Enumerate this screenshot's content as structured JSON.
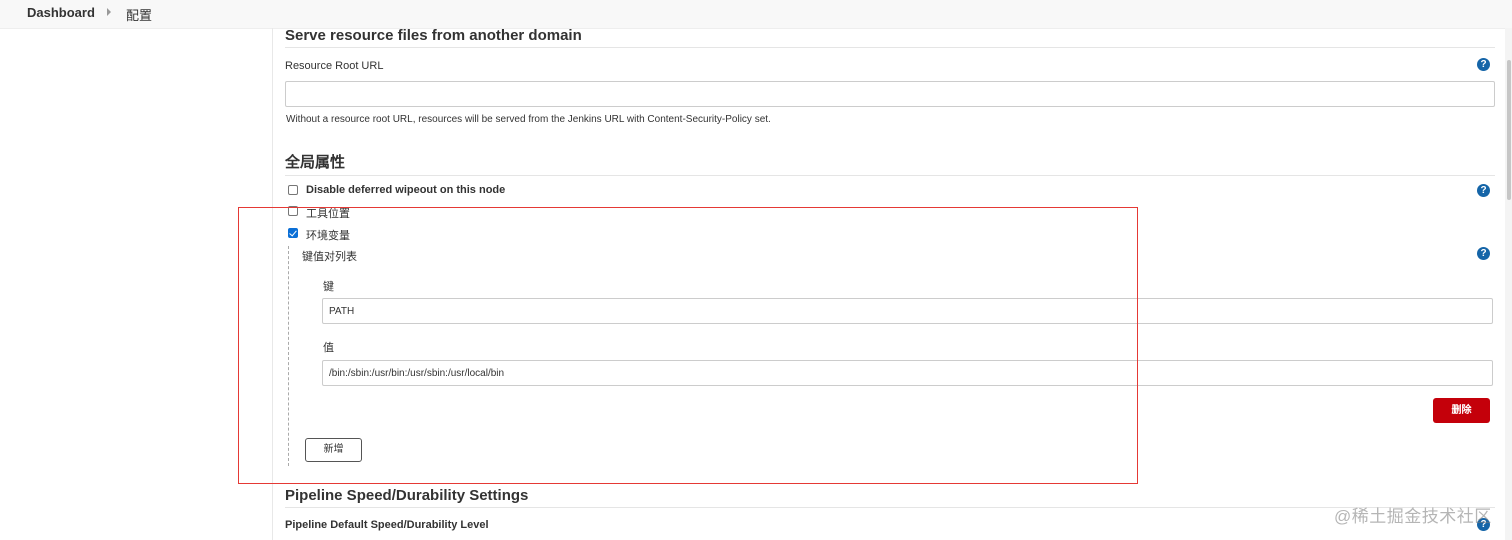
{
  "breadcrumb": {
    "dashboard": "Dashboard",
    "current": "配置"
  },
  "resource_section": {
    "title": "Serve resource files from another domain",
    "field_label": "Resource Root URL",
    "input_value": "",
    "helper": "Without a resource root URL, resources will be served from the Jenkins URL with Content-Security-Policy set."
  },
  "global_props": {
    "title": "全局属性",
    "options": [
      {
        "label": "Disable deferred wipeout on this node",
        "checked": false
      },
      {
        "label": "工具位置",
        "checked": false
      },
      {
        "label": "环境变量",
        "checked": true
      }
    ],
    "kv_list_label": "键值对列表",
    "key_label": "键",
    "key_value": "PATH",
    "value_label": "值",
    "value_value": "/bin:/sbin:/usr/bin:/usr/sbin:/usr/local/bin",
    "delete_button": "删除",
    "add_button": "新增"
  },
  "pipeline_section": {
    "title": "Pipeline Speed/Durability Settings",
    "field_label": "Pipeline Default Speed/Durability Level"
  },
  "help_glyph": "?",
  "watermark": "@稀土掘金技术社区",
  "colors": {
    "help_icon": "#1565a8",
    "delete_button": "#c4000a",
    "checkbox_checked": "#0b6fd6",
    "highlight_box": "#e53935"
  }
}
